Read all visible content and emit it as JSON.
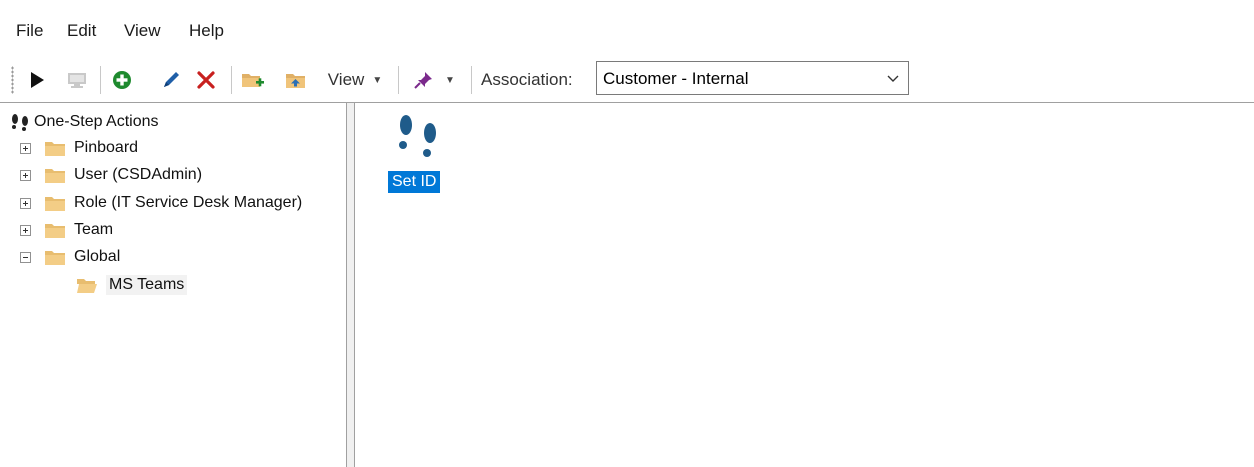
{
  "menu": {
    "file": "File",
    "edit": "Edit",
    "view": "View",
    "help": "Help"
  },
  "toolbar": {
    "view_label": "View",
    "association_label": "Association:",
    "association_value": "Customer - Internal",
    "icons": [
      "run-icon",
      "disabled-run-icon",
      "add-icon",
      "edit-icon",
      "delete-icon",
      "new-folder-icon",
      "folder-up-icon",
      "pin-icon"
    ],
    "colors": {
      "add": "#1e8a2e",
      "edit": "#1f5fa8",
      "delete": "#c8201f",
      "folder": "#e0b066",
      "pin": "#7b2a8c"
    }
  },
  "tree": {
    "root": "One-Step Actions",
    "items": [
      {
        "label": "Pinboard",
        "expander": "plus"
      },
      {
        "label": "User (CSDAdmin)",
        "expander": "plus"
      },
      {
        "label": "Role (IT Service Desk Manager)",
        "expander": "plus"
      },
      {
        "label": "Team",
        "expander": "plus"
      },
      {
        "label": "Global",
        "expander": "minus"
      }
    ],
    "child": "MS Teams"
  },
  "content": {
    "action_label": "Set ID",
    "selection_color": "#0078d7"
  }
}
